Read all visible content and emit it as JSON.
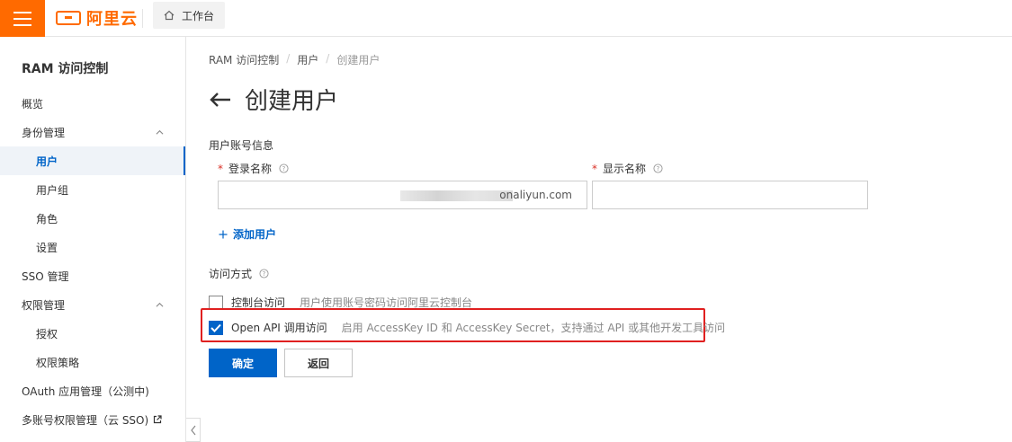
{
  "topbar": {
    "logo_text": "阿里云",
    "workbench_label": "工作台",
    "accent_color": "#ff6a00"
  },
  "sidebar": {
    "title": "RAM 访问控制",
    "items": [
      {
        "label": "概览"
      },
      {
        "label": "身份管理"
      },
      {
        "label": "用户"
      },
      {
        "label": "用户组"
      },
      {
        "label": "角色"
      },
      {
        "label": "设置"
      },
      {
        "label": "SSO 管理"
      },
      {
        "label": "权限管理"
      },
      {
        "label": "授权"
      },
      {
        "label": "权限策略"
      },
      {
        "label": "OAuth 应用管理（公测中)"
      },
      {
        "label": "多账号权限管理（云 SSO)"
      }
    ]
  },
  "breadcrumb": {
    "items": [
      "RAM 访问控制",
      "用户",
      "创建用户"
    ],
    "separator": "/"
  },
  "page": {
    "title": "创建用户"
  },
  "form": {
    "section_user_info": "用户账号信息",
    "login_name_label": "登录名称",
    "login_name_value_suffix": "onaliyun.com",
    "display_name_label": "显示名称",
    "display_name_value": "",
    "add_user_label": "添加用户",
    "access_mode_label": "访问方式",
    "console_access_label": "控制台访问",
    "console_access_desc": "用户使用账号密码访问阿里云控制台",
    "console_access_checked": false,
    "api_access_label": "Open API 调用访问",
    "api_access_desc": "启用 AccessKey ID 和 AccessKey Secret，支持通过 API 或其他开发工具访问",
    "api_access_checked": true,
    "confirm_label": "确定",
    "back_label": "返回"
  },
  "colors": {
    "primary": "#0064c8",
    "highlight": "#e02020",
    "required": "#d93026"
  }
}
